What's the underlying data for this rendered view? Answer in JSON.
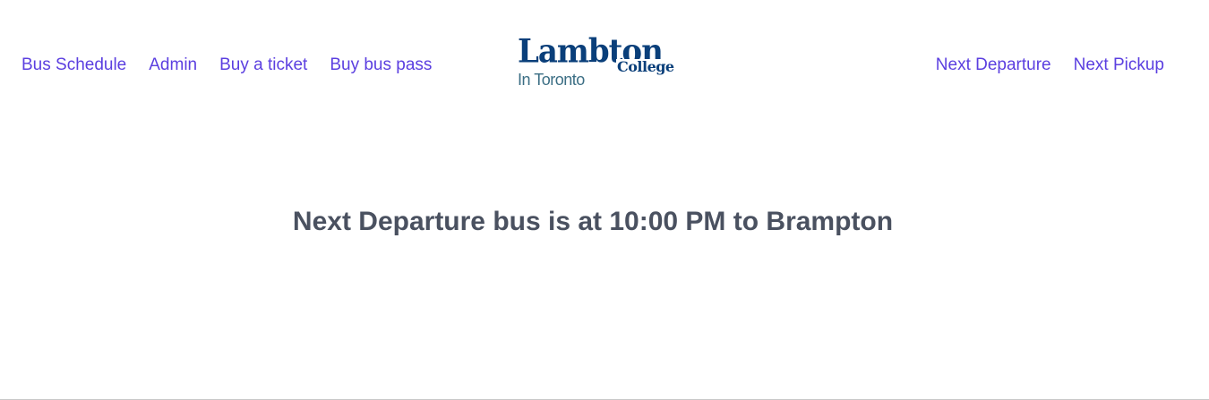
{
  "nav_left": {
    "bus_schedule": "Bus Schedule",
    "admin": "Admin",
    "buy_ticket": "Buy a ticket",
    "buy_pass": "Buy bus pass"
  },
  "logo": {
    "main": "Lambton",
    "college": "College",
    "sub": "In Toronto"
  },
  "nav_right": {
    "next_departure": "Next Departure",
    "next_pickup": "Next Pickup"
  },
  "main": {
    "headline": "Next Departure bus is at 10:00 PM to Brampton"
  },
  "colors": {
    "link": "#5b3fe0",
    "logo_blue": "#0a3f7a",
    "headline": "#4a5160"
  }
}
